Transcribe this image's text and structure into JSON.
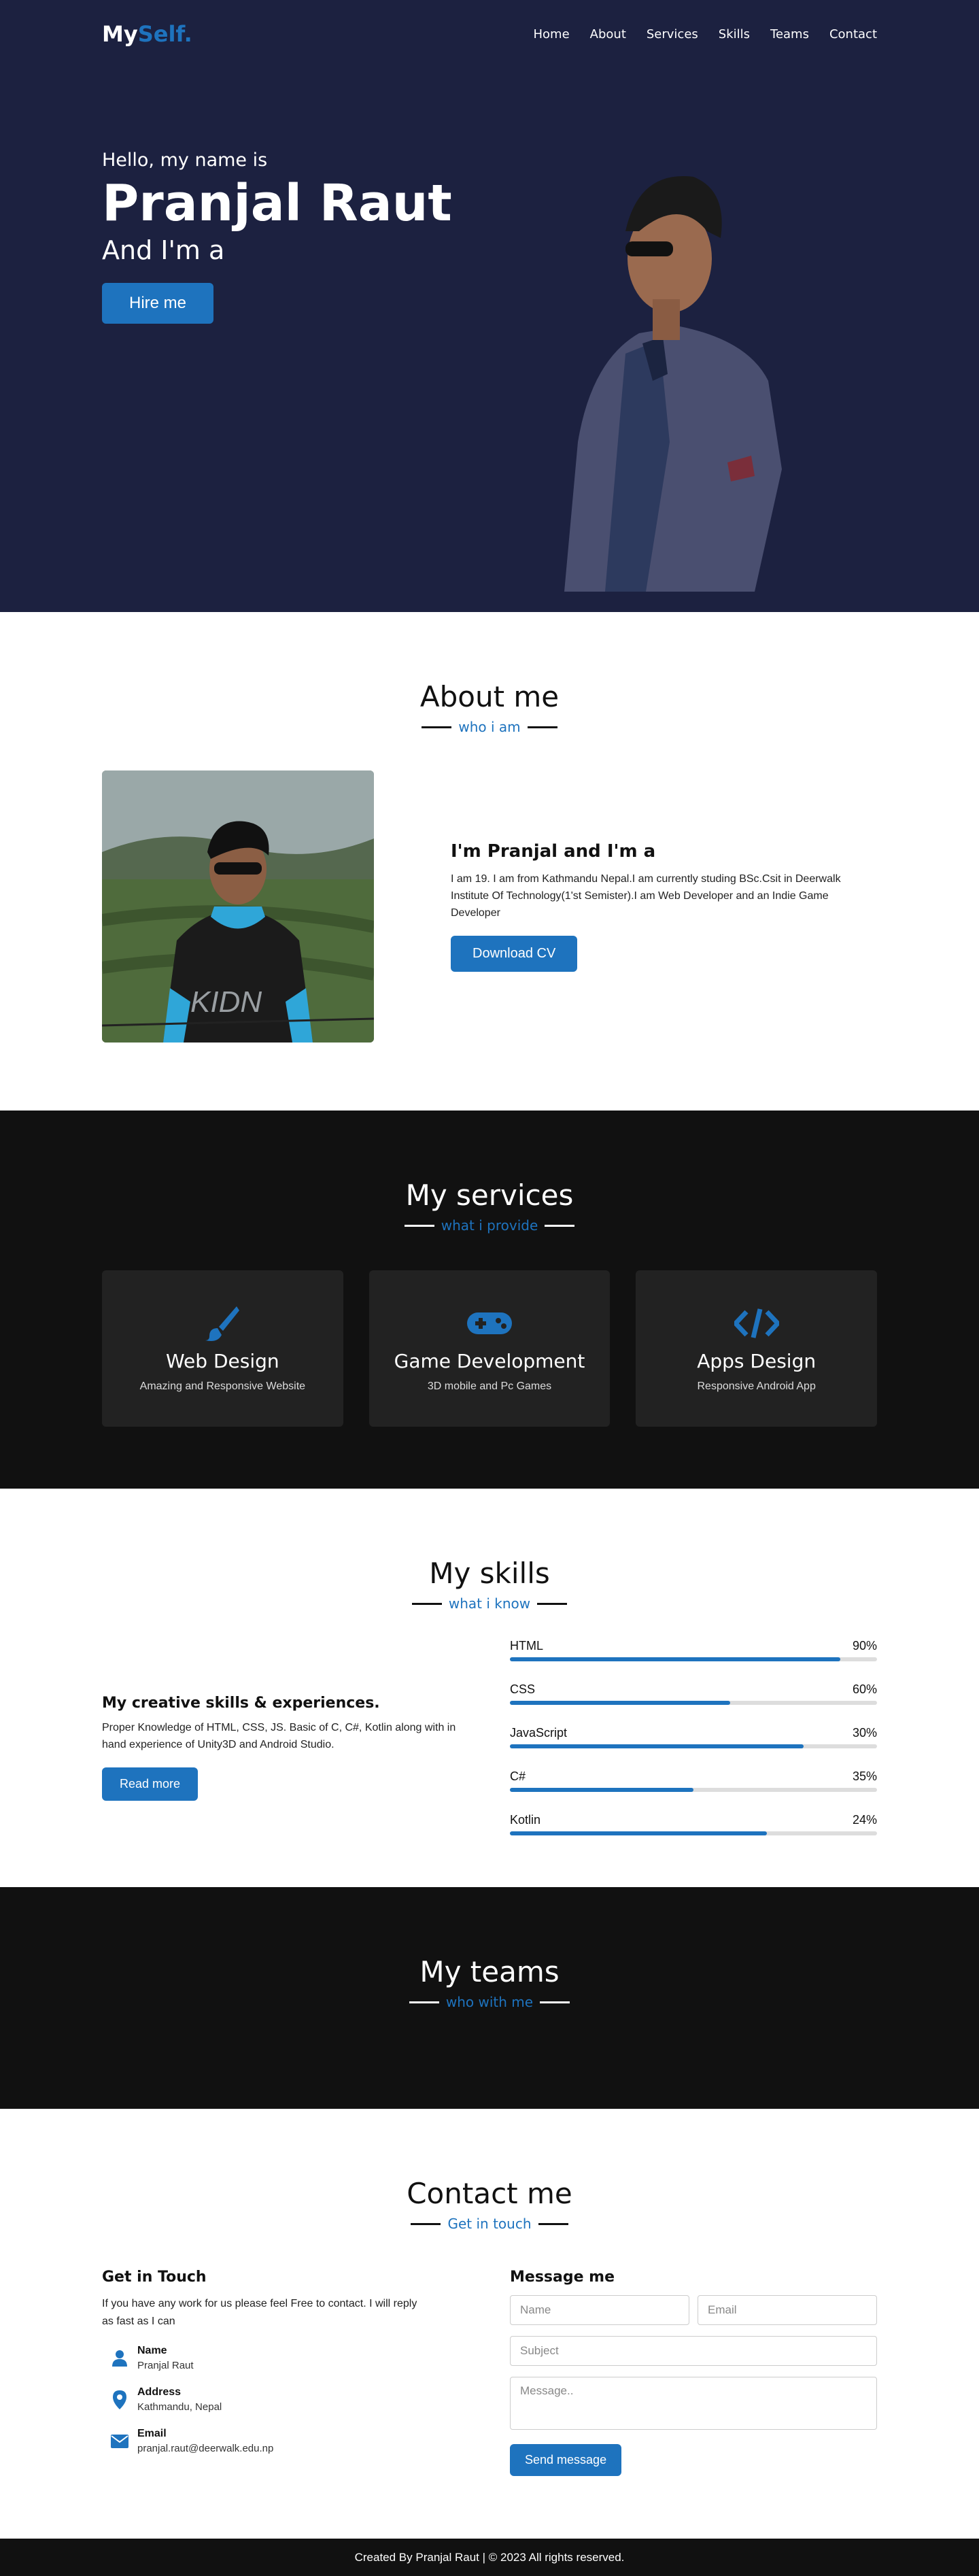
{
  "nav": {
    "logo_main": "My",
    "logo_accent": "Self.",
    "items": [
      "Home",
      "About",
      "Services",
      "Skills",
      "Teams",
      "Contact"
    ]
  },
  "hero": {
    "hello": "Hello, my name is",
    "name": "Pranjal Raut",
    "role": "And I'm a",
    "button": "Hire me"
  },
  "about": {
    "title": "About me",
    "subtitle": "who i am",
    "heading": "I'm Pranjal and I'm a",
    "text": "I am 19. I am from Kathmandu Nepal.I am currently studing BSc.Csit in Deerwalk Institute Of Technology(1'st Semister).I am Web Developer and an Indie Game Developer",
    "button": "Download CV"
  },
  "services": {
    "title": "My services",
    "subtitle": "what i provide",
    "cards": [
      {
        "icon": "paint-brush-icon",
        "title": "Web Design",
        "desc": "Amazing and Responsive Website"
      },
      {
        "icon": "gamepad-icon",
        "title": "Game Development",
        "desc": "3D mobile and Pc Games"
      },
      {
        "icon": "code-icon",
        "title": "Apps Design",
        "desc": "Responsive Android App"
      }
    ]
  },
  "skills": {
    "title": "My skills",
    "subtitle": "what i know",
    "heading": "My creative skills & experiences.",
    "text": "Proper Knowledge of HTML, CSS, JS. Basic of C, C#, Kotlin along with in hand experience of Unity3D and Android Studio.",
    "button": "Read more",
    "bars": [
      {
        "name": "HTML",
        "label": "90%",
        "fill": 0.9
      },
      {
        "name": "CSS",
        "label": "60%",
        "fill": 0.6
      },
      {
        "name": "JavaScript",
        "label": "30%",
        "fill": 0.8
      },
      {
        "name": "C#",
        "label": "35%",
        "fill": 0.5
      },
      {
        "name": "Kotlin",
        "label": "24%",
        "fill": 0.7
      }
    ]
  },
  "teams": {
    "title": "My teams",
    "subtitle": "who with me"
  },
  "contact": {
    "title": "Contact me",
    "subtitle": "Get in touch",
    "left_heading": "Get in Touch",
    "intro": "If you have any work for us please feel Free to contact. I will reply as fast as I can",
    "info": [
      {
        "icon": "person-icon",
        "label": "Name",
        "value": "Pranjal Raut"
      },
      {
        "icon": "map-marker-icon",
        "label": "Address",
        "value": "Kathmandu, Nepal"
      },
      {
        "icon": "envelope-icon",
        "label": "Email",
        "value": "pranjal.raut@deerwalk.edu.np"
      }
    ],
    "right_heading": "Message me",
    "placeholders": {
      "name": "Name",
      "email": "Email",
      "subject": "Subject",
      "message": "Message.."
    },
    "button": "Send message"
  },
  "footer": {
    "text": "Created By Pranjal Raut | © 2023 All rights reserved."
  },
  "colors": {
    "accent": "#1e73be",
    "hero_bg": "#1c2140",
    "dark_bg": "#111111",
    "card_bg": "#222222"
  }
}
